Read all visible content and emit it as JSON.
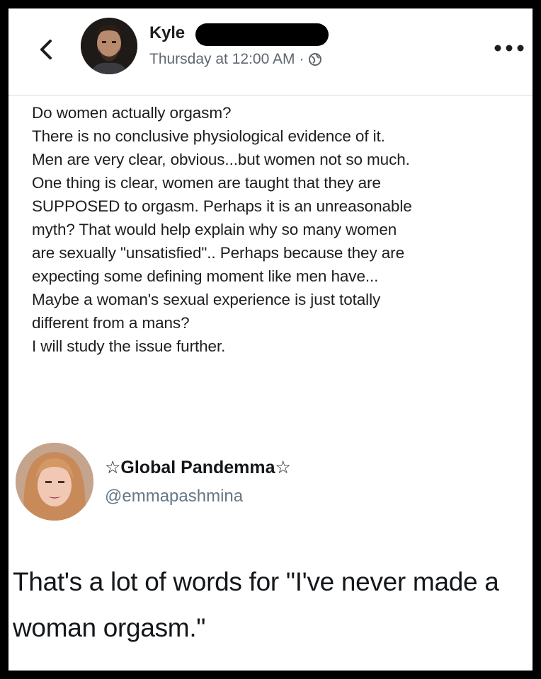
{
  "post": {
    "author_name": "Kyle",
    "timestamp": "Thursday at 12:00 AM",
    "separator": "·",
    "privacy_icon": "globe-icon",
    "back_icon": "chevron-left-icon",
    "more_icon": "more-dots-icon",
    "text": "Do women actually orgasm?\nThere is no conclusive physiological evidence of it.\nMen are very clear, obvious...but women not so much.\nOne thing is clear, women are taught that they are\nSUPPOSED to orgasm.  Perhaps it is an unreasonable\nmyth?  That would help explain why so many women\nare sexually \"unsatisfied\".. Perhaps because they are\nexpecting some defining moment like men have...\nMaybe a woman's sexual experience is just totally\ndifferent from a mans?\nI will study the issue further."
  },
  "reply": {
    "display_name": "☆Global Pandemma☆",
    "handle": "@emmapashmina",
    "text": "That's a lot of words for \"I've never made a woman orgasm.\""
  },
  "colors": {
    "frame_border": "#000000",
    "background": "#ffffff",
    "primary_text": "#1c1e21",
    "secondary_text": "#606770",
    "handle_text": "#657786"
  }
}
